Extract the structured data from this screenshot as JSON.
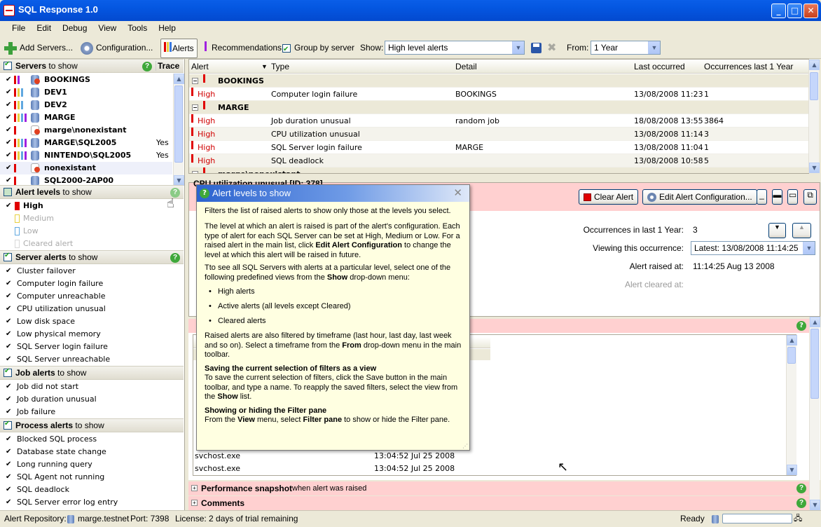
{
  "window": {
    "title": "SQL Response 1.0"
  },
  "menu": [
    "File",
    "Edit",
    "Debug",
    "View",
    "Tools",
    "Help"
  ],
  "toolbar": {
    "add_servers": "Add Servers...",
    "configuration": "Configuration...",
    "alerts": "Alerts",
    "recommendations": "Recommendations",
    "group_by_server": "Group by server",
    "show_label": "Show:",
    "show_value": "High level alerts",
    "from_label": "From:",
    "from_value": "1  Year"
  },
  "servers_section": {
    "title_bold": "Servers",
    "title_rest": " to show",
    "trace": "Trace",
    "servers": [
      {
        "name": "BOOKINGS",
        "trace": ""
      },
      {
        "name": "DEV1",
        "trace": ""
      },
      {
        "name": "DEV2",
        "trace": ""
      },
      {
        "name": "MARGE",
        "trace": ""
      },
      {
        "name": "marge\\nonexistant",
        "trace": ""
      },
      {
        "name": "MARGE\\SQL2005",
        "trace": "Yes"
      },
      {
        "name": "NINTENDO\\SQL2005",
        "trace": "Yes"
      },
      {
        "name": "nonexistant",
        "trace": ""
      },
      {
        "name": "SQL2000-2AP00",
        "trace": ""
      }
    ]
  },
  "alert_levels_section": {
    "title_bold": "Alert levels",
    "title_rest": " to show",
    "levels": [
      "High",
      "Medium",
      "Low",
      "Cleared alert"
    ]
  },
  "server_alerts_section": {
    "title_bold": "Server alerts",
    "title_rest": " to show",
    "items": [
      "Cluster failover",
      "Computer login failure",
      "Computer unreachable",
      "CPU utilization unusual",
      "Low disk space",
      "Low physical memory",
      "SQL Server login failure",
      "SQL Server unreachable"
    ]
  },
  "job_alerts_section": {
    "title_bold": "Job alerts",
    "title_rest": " to show",
    "items": [
      "Job did not start",
      "Job duration unusual",
      "Job failure"
    ]
  },
  "process_alerts_section": {
    "title_bold": "Process alerts",
    "title_rest": " to show",
    "items": [
      "Blocked SQL process",
      "Database state change",
      "Long running query",
      "SQL Agent not running",
      "SQL deadlock",
      "SQL Server error log entry"
    ]
  },
  "grid": {
    "columns": [
      "Alert",
      "Type",
      "Detail",
      "Last occurred",
      "Occurrences last 1 Year"
    ],
    "rows": [
      {
        "group": "BOOKINGS"
      },
      {
        "level": "High",
        "type": "Computer login failure",
        "detail": "BOOKINGS",
        "last": "13/08/2008 11:23",
        "count": "1"
      },
      {
        "group": "MARGE"
      },
      {
        "level": "High",
        "type": "Job duration unusual",
        "detail": "random job",
        "last": "18/08/2008 13:55",
        "count": "3864"
      },
      {
        "level": "High",
        "type": "CPU utilization unusual",
        "detail": "",
        "last": "13/08/2008 11:14",
        "count": "3"
      },
      {
        "level": "High",
        "type": "SQL Server login failure",
        "detail": "MARGE",
        "last": "13/08/2008 11:04",
        "count": "1"
      },
      {
        "level": "High",
        "type": "SQL deadlock",
        "detail": "",
        "last": "13/08/2008 10:58",
        "count": "5"
      },
      {
        "group": "marge\\nonexistant"
      }
    ]
  },
  "detail": {
    "header_fragment": "CPU utilization unusual [ID: 378]",
    "clear_alert": "Clear Alert",
    "edit_config": "Edit Alert Configuration...",
    "occurrences_label": "Occurrences in last 1  Year:",
    "occurrences_value": "3",
    "viewing_label": "Viewing this occurrence:",
    "viewing_value": "Latest: 13/08/2008 11:14:25",
    "raised_label": "Alert raised at:",
    "raised_value": "11:14:25 Aug 13 2008",
    "cleared_label": "Alert cleared at:"
  },
  "processes": [
    {
      "name": "svchost.exe",
      "time": "13:04:52 Jul 25 2008"
    },
    {
      "name": "svchost.exe",
      "time": "13:04:52 Jul 25 2008"
    }
  ],
  "strips": {
    "perf_bold": "Performance snapshot",
    "perf_rest": "  when alert was raised",
    "comments": "Comments"
  },
  "popup": {
    "title": "Alert levels to show",
    "p1": "Filters the list of raised alerts to show only those at the levels you select.",
    "p2a": "The level at which an alert is raised is part of the alert's configuration. Each type of alert for each SQL Server can be set at High, Medium or Low. For a raised alert in the main list, click ",
    "p2b": "Edit Alert Configuration",
    "p2c": " to change the level at which this alert will be raised in future.",
    "p3a": "Tto see all SQL Servers with alerts at a particular level, select one of the following predefined views from the ",
    "p3b": "Show",
    "p3c": " drop-down menu:",
    "bullets": [
      "High alerts",
      "Active alerts  (all levels except Cleared)",
      "Cleared alerts"
    ],
    "p4a": "Raised alerts are also filtered by timeframe (last hour, last day, last week and so on). Select a timeframe from the ",
    "p4b": "From",
    "p4c": " drop-down menu in the main toolbar.",
    "h5": "Saving the current selection of filters as a view",
    "p5a": "To save the current selection of filters, click the Save button in the main toolbar, and type a name. To reapply the saved filters, select the view from the ",
    "p5b": "Show",
    "p5c": " list.",
    "h6": "Showing or hiding the Filter pane",
    "p6a": "From the ",
    "p6b": "View",
    "p6c": " menu, select ",
    "p6d": "Filter pane",
    "p6e": " to show or hide the Filter pane."
  },
  "statusbar": {
    "repo_label": "Alert Repository:",
    "repo_server": "marge.testnet",
    "port": "Port: 7398",
    "license": "License: 2 days of trial remaining",
    "ready": "Ready"
  },
  "colors": {
    "high": "#e00000",
    "medium": "#e8d040",
    "low": "#60a8e0",
    "purple": "#a020e0",
    "detail_bg": "#ffd0d0",
    "popup_bg": "#ffffe1"
  }
}
